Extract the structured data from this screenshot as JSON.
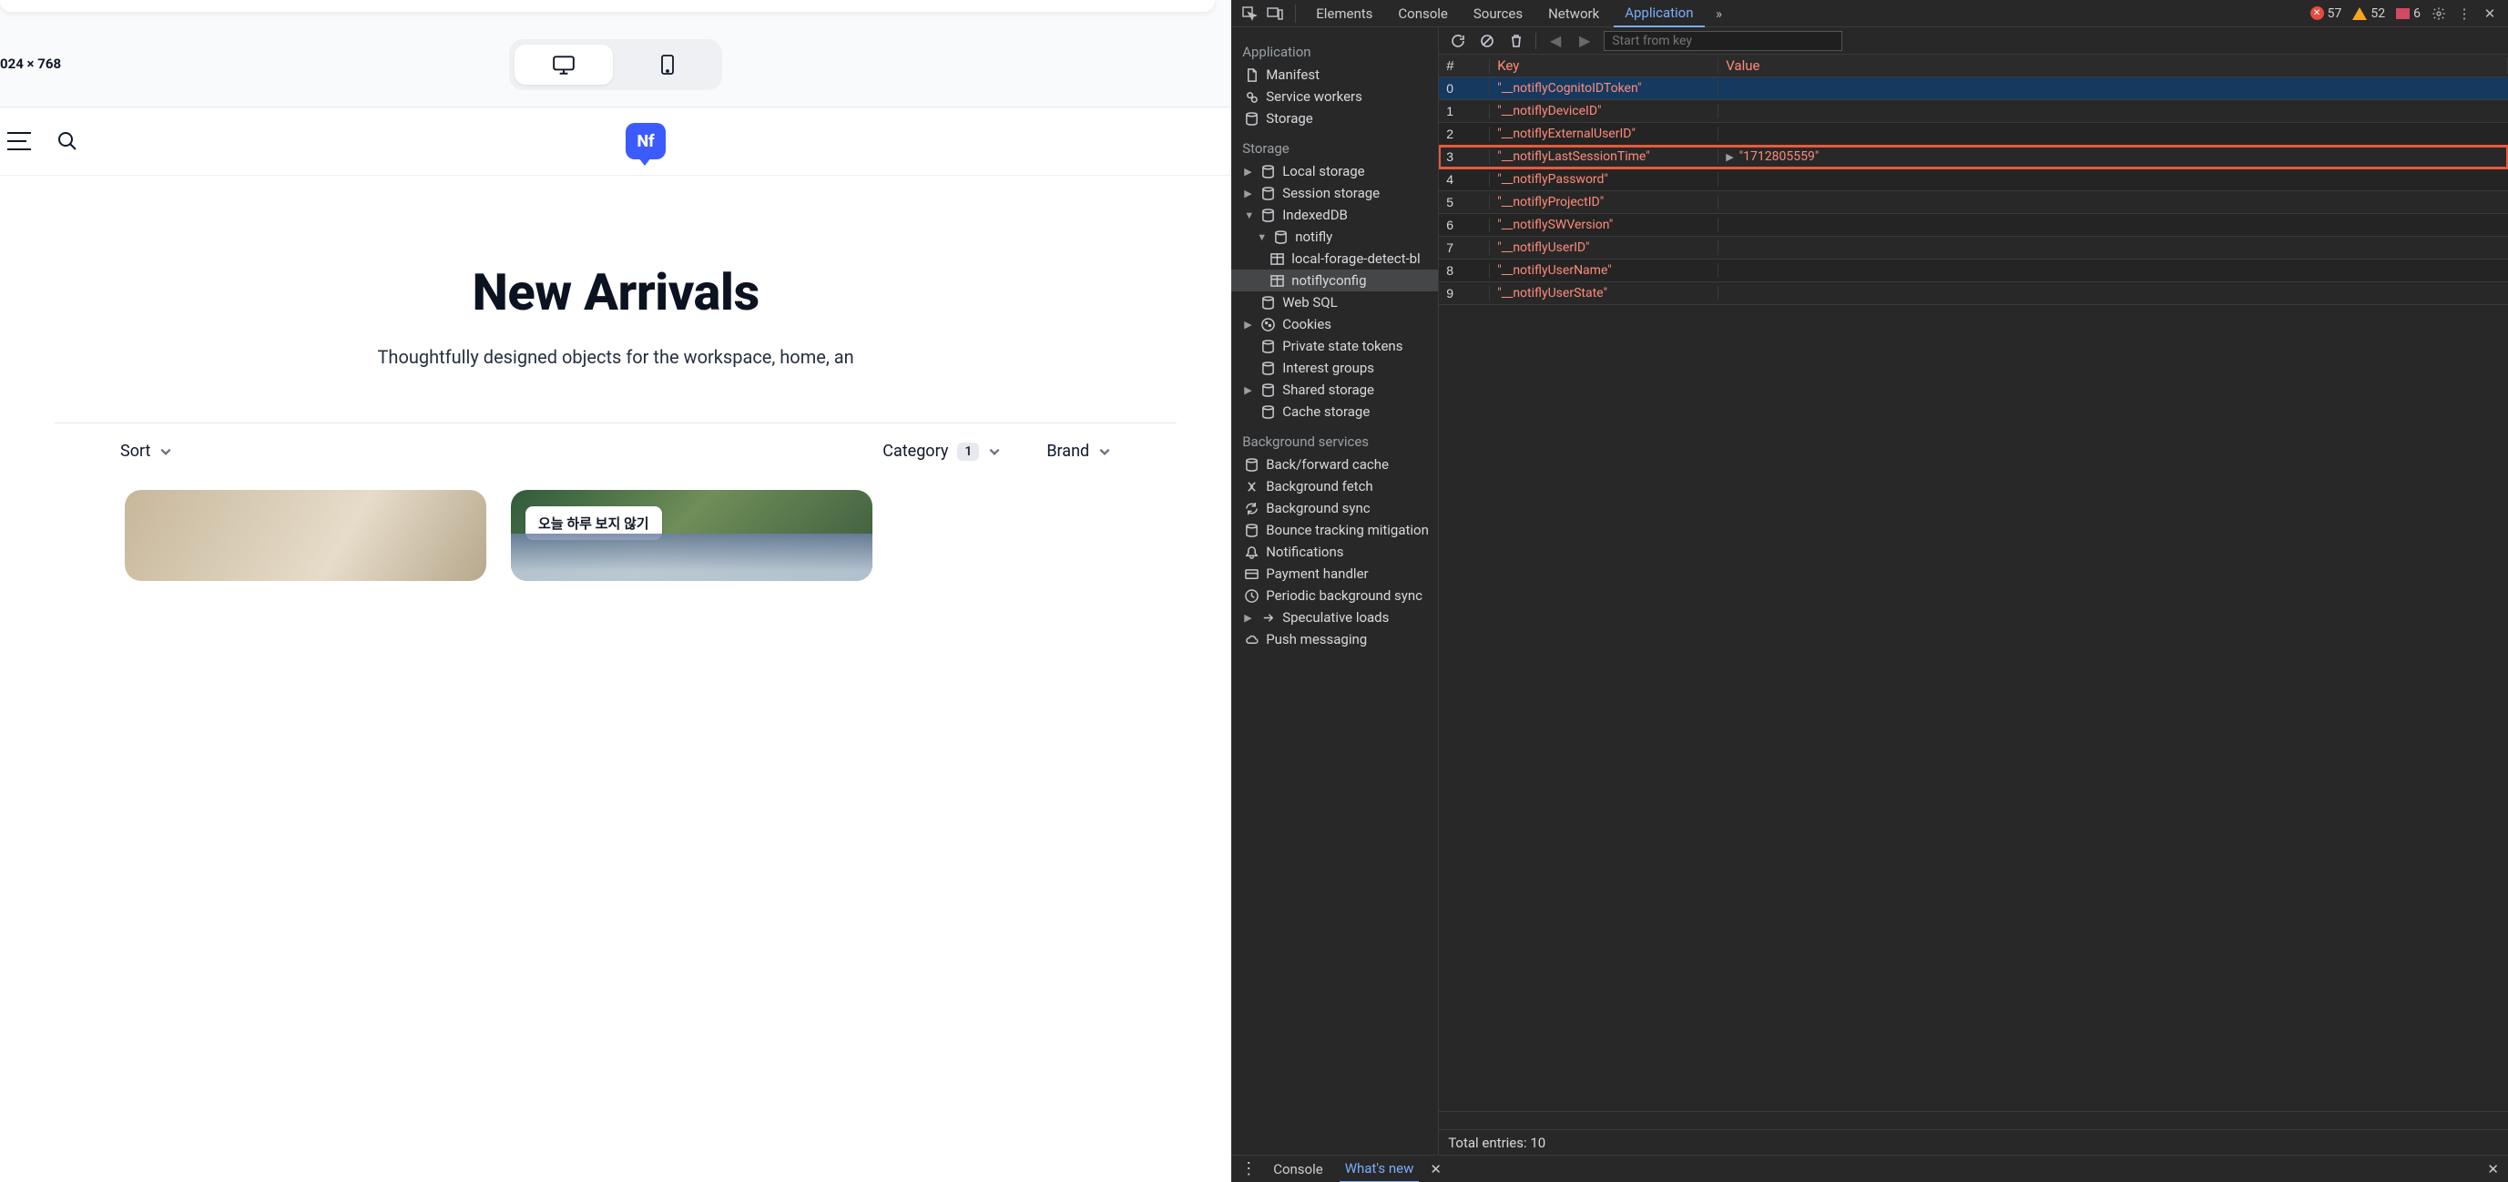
{
  "viewport_label": "024 × 768",
  "hero": {
    "title": "New Arrivals",
    "subtitle": "Thoughtfully designed objects for the workspace, home, an"
  },
  "filters": {
    "sort_label": "Sort",
    "category_label": "Category",
    "category_count": "1",
    "brand_label": "Brand"
  },
  "dismiss_chip": "오늘 하루 보지 않기",
  "devtools": {
    "tabs": [
      "Elements",
      "Console",
      "Sources",
      "Network",
      "Application"
    ],
    "active_tab": "Application",
    "issues": {
      "errors": "57",
      "warnings": "52",
      "flags": "6"
    },
    "search_placeholder": "Start from key",
    "sidebar": {
      "application_title": "Application",
      "application_items": [
        "Manifest",
        "Service workers",
        "Storage"
      ],
      "storage_title": "Storage",
      "local_storage": "Local storage",
      "session_storage": "Session storage",
      "indexeddb": "IndexedDB",
      "idb_db": "notifly",
      "idb_store1": "local-forage-detect-bl",
      "idb_store2": "notiflyconfig",
      "web_sql": "Web SQL",
      "cookies": "Cookies",
      "pst": "Private state tokens",
      "interest": "Interest groups",
      "shared": "Shared storage",
      "cache": "Cache storage",
      "bg_title": "Background services",
      "bg_items": [
        "Back/forward cache",
        "Background fetch",
        "Background sync",
        "Bounce tracking mitigation",
        "Notifications",
        "Payment handler",
        "Periodic background sync",
        "Speculative loads",
        "Push messaging"
      ]
    },
    "table": {
      "cols": [
        "#",
        "Key",
        "Value"
      ],
      "rows": [
        {
          "idx": "0",
          "key": "\"__notiflyCognitoIDToken\"",
          "val": ""
        },
        {
          "idx": "1",
          "key": "\"__notiflyDeviceID\"",
          "val": ""
        },
        {
          "idx": "2",
          "key": "\"__notiflyExternalUserID\"",
          "val": ""
        },
        {
          "idx": "3",
          "key": "\"__notiflyLastSessionTime\"",
          "val": "\"1712805559\""
        },
        {
          "idx": "4",
          "key": "\"__notiflyPassword\"",
          "val": ""
        },
        {
          "idx": "5",
          "key": "\"__notiflyProjectID\"",
          "val": ""
        },
        {
          "idx": "6",
          "key": "\"__notiflySWVersion\"",
          "val": ""
        },
        {
          "idx": "7",
          "key": "\"__notiflyUserID\"",
          "val": ""
        },
        {
          "idx": "8",
          "key": "\"__notiflyUserName\"",
          "val": ""
        },
        {
          "idx": "9",
          "key": "\"__notiflyUserState\"",
          "val": ""
        }
      ],
      "total": "Total entries: 10"
    },
    "drawer": {
      "console": "Console",
      "whatsnew": "What's new"
    }
  }
}
